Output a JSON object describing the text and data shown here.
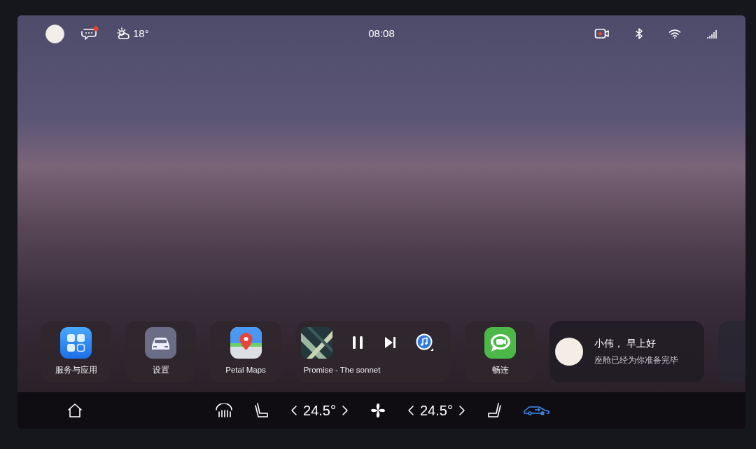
{
  "status_bar": {
    "messages_unread": true,
    "temperature": "18°",
    "time": "08:08",
    "dashcam_recording": true
  },
  "dock": [
    {
      "kind": "app",
      "label": "服务与应用"
    },
    {
      "kind": "app",
      "label": "设置"
    },
    {
      "kind": "app",
      "label": "Petal Maps"
    },
    {
      "kind": "media",
      "title": "Promise - The sonnet",
      "playing": true
    },
    {
      "kind": "app",
      "label": "畅连"
    },
    {
      "kind": "greeting",
      "title": "小伟， 早上好",
      "subtitle": "座舱已经为你准备完毕"
    },
    {
      "kind": "partial"
    }
  ],
  "bottom_bar": {
    "left_temp": "24.5°",
    "right_temp": "24.5°",
    "car_mode_active": true
  }
}
